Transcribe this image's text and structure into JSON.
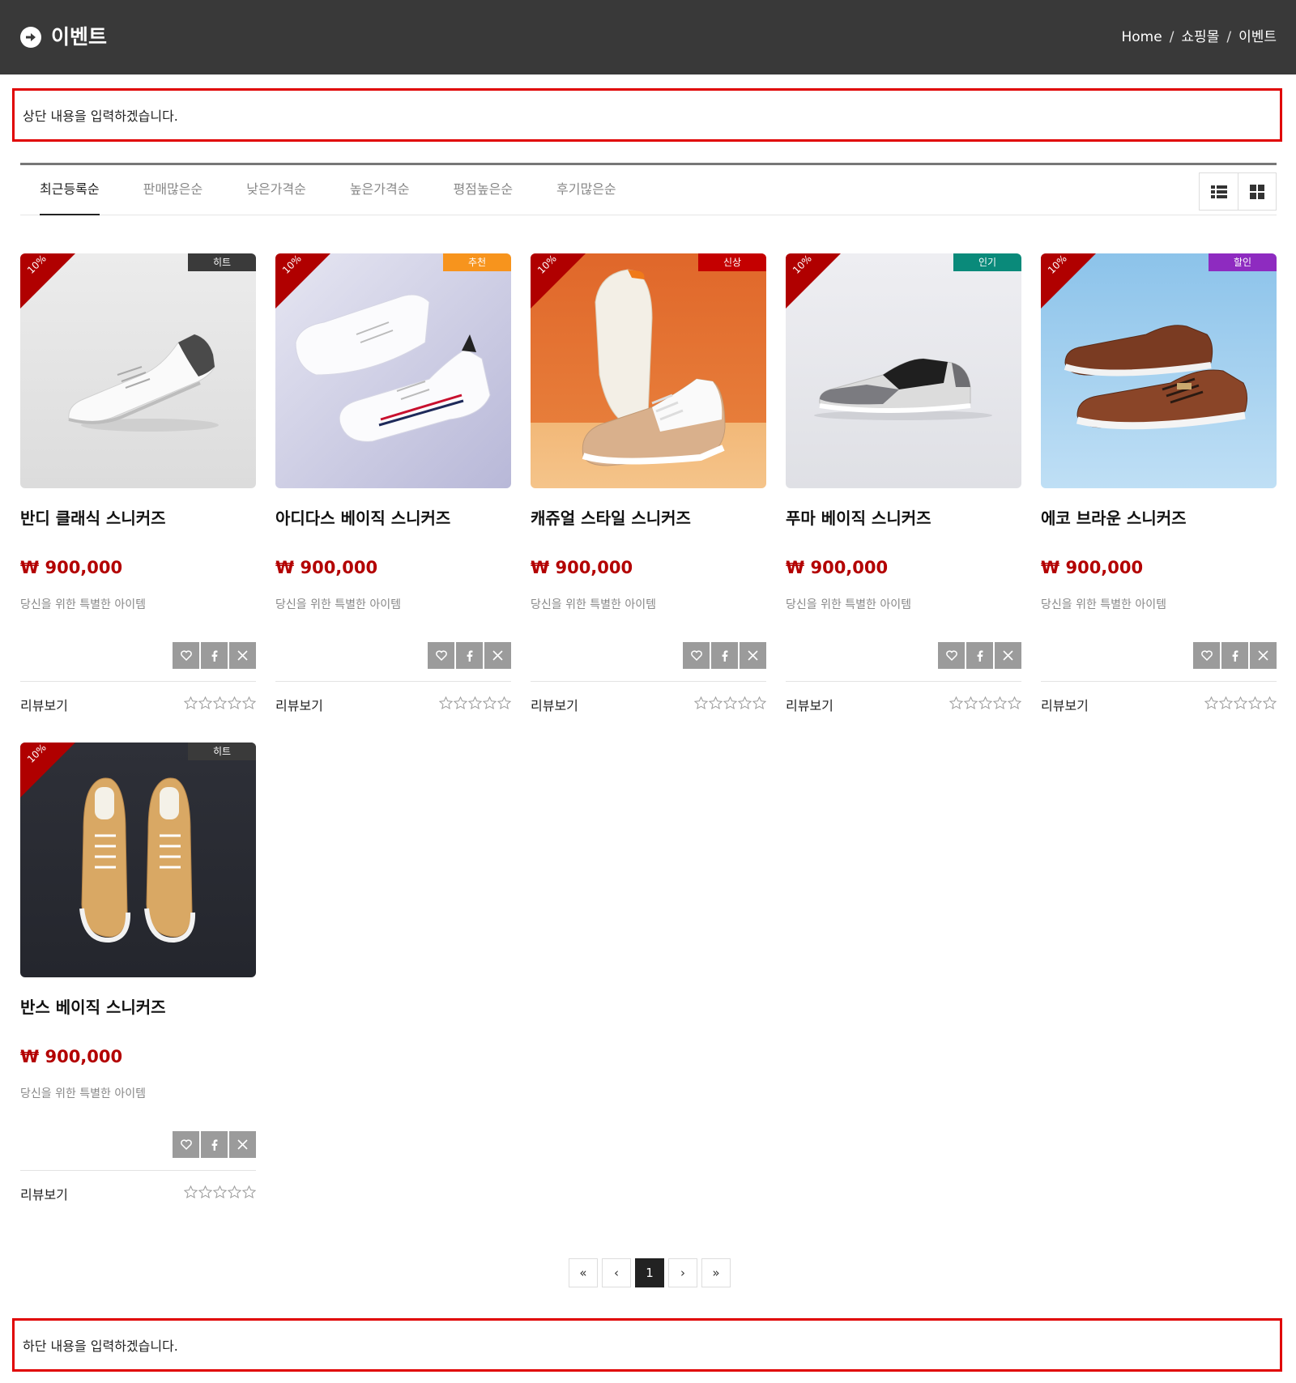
{
  "header": {
    "title": "이벤트",
    "breadcrumb": [
      "Home",
      "쇼핑몰",
      "이벤트"
    ],
    "breadcrumb_separator": "/"
  },
  "top_note": "상단 내용을 입력하겠습니다.",
  "bottom_note": "하단 내용을 입력하겠습니다.",
  "sort_tabs": [
    "최근등록순",
    "판매많은순",
    "낮은가격순",
    "높은가격순",
    "평점높은순",
    "후기많은순"
  ],
  "active_sort": "최근등록순",
  "view_modes": [
    "list-view-icon",
    "grid-view-icon"
  ],
  "colors": {
    "header_bg": "#393939",
    "accent_red": "#b30000",
    "discount_red": "#b00000",
    "note_border": "#e00000",
    "action_btn": "#9b9b9b"
  },
  "products": [
    {
      "name": "반디 클래식 스니커즈",
      "price": "₩ 900,000",
      "desc": "당신을 위한 특별한 아이템",
      "discount": "10%",
      "tag": "히트",
      "tag_color": "#3a3a3a",
      "review_label": "리뷰보기",
      "rating": 0
    },
    {
      "name": "아디다스 베이직 스니커즈",
      "price": "₩ 900,000",
      "desc": "당신을 위한 특별한 아이템",
      "discount": "10%",
      "tag": "추천",
      "tag_color": "#f7941d",
      "review_label": "리뷰보기",
      "rating": 0
    },
    {
      "name": "캐쥬얼 스타일 스니커즈",
      "price": "₩ 900,000",
      "desc": "당신을 위한 특별한 아이템",
      "discount": "10%",
      "tag": "신상",
      "tag_color": "#c40000",
      "review_label": "리뷰보기",
      "rating": 0
    },
    {
      "name": "푸마 베이직 스니커즈",
      "price": "₩ 900,000",
      "desc": "당신을 위한 특별한 아이템",
      "discount": "10%",
      "tag": "인기",
      "tag_color": "#0a8a7a",
      "review_label": "리뷰보기",
      "rating": 0
    },
    {
      "name": "에코 브라운 스니커즈",
      "price": "₩ 900,000",
      "desc": "당신을 위한 특별한 아이템",
      "discount": "10%",
      "tag": "할인",
      "tag_color": "#8e2bc0",
      "review_label": "리뷰보기",
      "rating": 0
    },
    {
      "name": "반스 베이직 스니커즈",
      "price": "₩ 900,000",
      "desc": "당신을 위한 특별한 아이템",
      "discount": "10%",
      "tag": "히트",
      "tag_color": "#3a3a3a",
      "review_label": "리뷰보기",
      "rating": 0
    }
  ],
  "pagination": {
    "first": "«",
    "prev": "‹",
    "pages": [
      "1"
    ],
    "current": "1",
    "next": "›",
    "last": "»"
  }
}
